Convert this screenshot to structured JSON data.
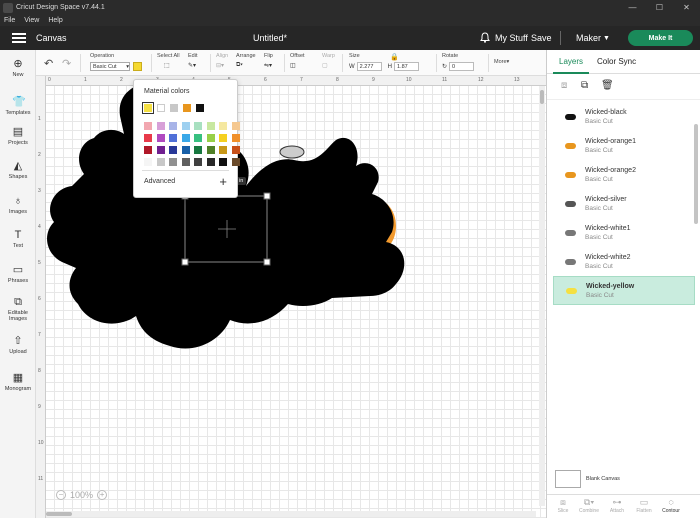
{
  "window": {
    "title": "Cricut Design Space  v7.44.1",
    "controls": [
      "—",
      "☐",
      "✕"
    ]
  },
  "menu": [
    "File",
    "View",
    "Help"
  ],
  "header": {
    "section": "Canvas",
    "doc_title": "Untitled*",
    "my_stuff": "My Stuff",
    "save": "Save",
    "machine": "Maker",
    "make_it": "Make It"
  },
  "left_nav": [
    {
      "label": "New",
      "icon": "plus-icon"
    },
    {
      "label": "Templates",
      "icon": "shirt-icon"
    },
    {
      "label": "Projects",
      "icon": "projects-icon"
    },
    {
      "label": "Shapes",
      "icon": "shapes-icon"
    },
    {
      "label": "Images",
      "icon": "bulb-icon"
    },
    {
      "label": "Text",
      "icon": "text-icon"
    },
    {
      "label": "Phrases",
      "icon": "phrases-icon"
    },
    {
      "label": "Editable Images",
      "icon": "editable-images-icon"
    },
    {
      "label": "Upload",
      "icon": "upload-icon"
    },
    {
      "label": "Monogram",
      "icon": "monogram-icon"
    }
  ],
  "toolbar": {
    "operation_label": "Operation",
    "operation_value": "Basic Cut",
    "select_all": "Select All",
    "edit": "Edit",
    "align": "Align",
    "arrange": "Arrange",
    "flip": "Flip",
    "offset": "Offset",
    "warp": "Warp",
    "size": "Size",
    "width_prefix": "W",
    "width_value": "2.277",
    "height_prefix": "H",
    "height_value": "1.87",
    "rotate": "Rotate",
    "rotate_value": "0",
    "more": "More▾",
    "position_x": "0",
    "position_y": "0"
  },
  "ruler_top": [
    "0",
    "1",
    "2",
    "3",
    "4",
    "5",
    "6",
    "7",
    "8",
    "9",
    "10",
    "11",
    "12",
    "13",
    "14",
    "15",
    "16",
    "17",
    "18",
    "19",
    "20"
  ],
  "ruler_left": [
    "1",
    "2",
    "3",
    "4",
    "5",
    "6",
    "7",
    "8",
    "9",
    "10",
    "11",
    "12",
    "13",
    "14",
    "15",
    "16"
  ],
  "zoom": {
    "value": "100%"
  },
  "dimension_tag": "in",
  "color_popover": {
    "title": "Material colors",
    "top_row": [
      "#f5e042",
      "#ffffff",
      "#c8c8c8",
      "#e8961e",
      "#111111"
    ],
    "grid": [
      "#f2a7b0",
      "#d8a0d8",
      "#a8b4e8",
      "#9ed0f0",
      "#a8e0c0",
      "#c8e8a0",
      "#f5e8a0",
      "#f5c890",
      "#e83a4a",
      "#b04ac0",
      "#5070d8",
      "#3aa8e8",
      "#38c080",
      "#98d048",
      "#f5d020",
      "#f0902a",
      "#b01828",
      "#702090",
      "#283898",
      "#1860a8",
      "#187840",
      "#508028",
      "#c89818",
      "#c85018",
      "#f5f5f5",
      "#c8c8c8",
      "#909090",
      "#606060",
      "#404040",
      "#282828",
      "#101010",
      "#6a4a2a"
    ],
    "advanced": "Advanced"
  },
  "right_panel": {
    "tabs": [
      "Layers",
      "Color Sync"
    ],
    "layers": [
      {
        "name": "Wicked-black",
        "op": "Basic Cut",
        "color": "#111111",
        "selected": false
      },
      {
        "name": "Wicked-orange1",
        "op": "Basic Cut",
        "color": "#e8961e",
        "selected": false
      },
      {
        "name": "Wicked-orange2",
        "op": "Basic Cut",
        "color": "#e8961e",
        "selected": false
      },
      {
        "name": "Wicked-silver",
        "op": "Basic Cut",
        "color": "#555555",
        "selected": false
      },
      {
        "name": "Wicked-white1",
        "op": "Basic Cut",
        "color": "#777777",
        "selected": false
      },
      {
        "name": "Wicked-white2",
        "op": "Basic Cut",
        "color": "#777777",
        "selected": false
      },
      {
        "name": "Wicked-yellow",
        "op": "Basic Cut",
        "color": "#f5e042",
        "selected": true
      }
    ],
    "blank_canvas": "Blank Canvas",
    "bottom_actions": [
      "Slice",
      "Combine",
      "Attach",
      "Flatten",
      "Contour"
    ]
  }
}
